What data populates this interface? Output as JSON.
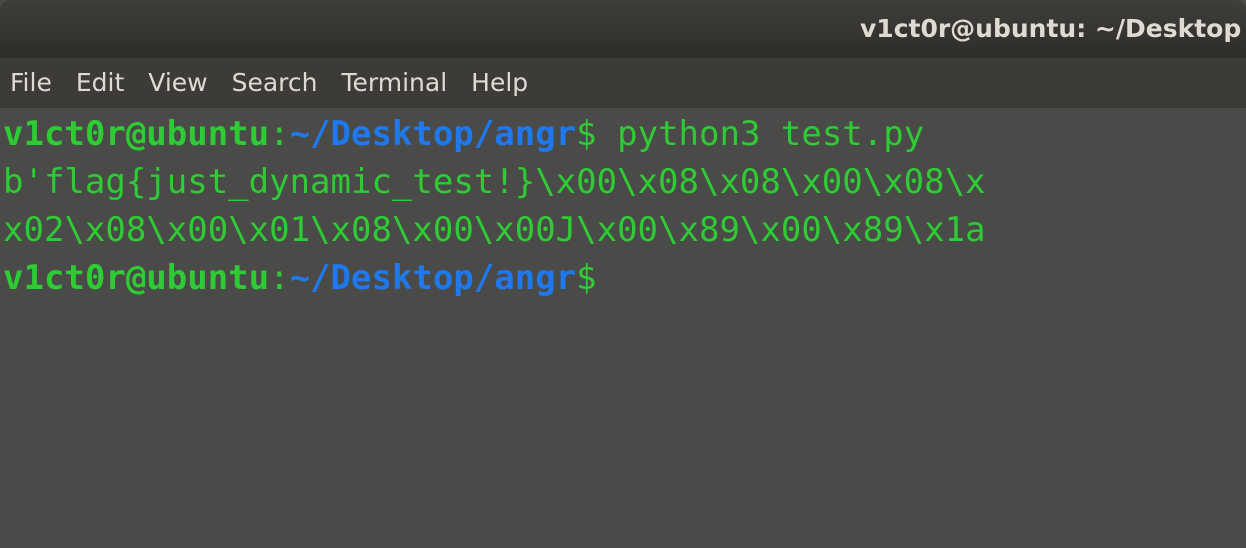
{
  "window": {
    "title": "v1ct0r@ubuntu: ~/Desktop"
  },
  "menu": {
    "items": [
      "File",
      "Edit",
      "View",
      "Search",
      "Terminal",
      "Help"
    ]
  },
  "terminal": {
    "prompt_user": "v1ct0r@ubuntu",
    "prompt_colon": ":",
    "prompt_path": "~/Desktop/angr",
    "prompt_dollar": "$",
    "command": " python3 test.py",
    "output_line_1": "b'flag{just_dynamic_test!}\\x00\\x08\\x08\\x00\\x08\\x",
    "output_line_2": "x02\\x08\\x00\\x01\\x08\\x00\\x00J\\x00\\x89\\x00\\x89\\x1a",
    "prompt2_user": "v1ct0r@ubuntu",
    "prompt2_colon": ":",
    "prompt2_path": "~/Desktop/angr",
    "prompt2_dollar": "$"
  },
  "colors": {
    "text_green": "#2ecb35",
    "path_blue": "#1f78ec",
    "terminal_bg": "#4a4a48",
    "titlebar_bg": "#3f3e3b",
    "menubar_bg": "#3c3b37"
  }
}
